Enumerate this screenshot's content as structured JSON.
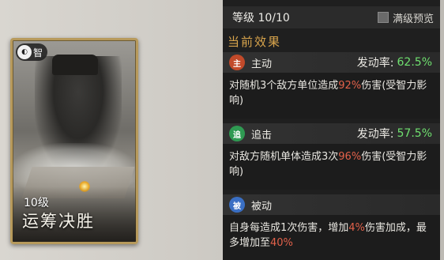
{
  "card": {
    "type_badge": "智",
    "level": "10级",
    "name": "运筹决胜"
  },
  "panel": {
    "level_text": "等级 10/10",
    "full_level_preview": "满级预览",
    "section_title": "当前效果",
    "effects": [
      {
        "icon": "主",
        "icon_color": "#c24a2a",
        "type": "主动",
        "rate_label": "发动率:",
        "rate": "62.5%",
        "desc_pre": "对随机3个敌方单位造成",
        "desc_hl": "92%",
        "desc_post": "伤害(受智力影响)"
      },
      {
        "icon": "追",
        "icon_color": "#2f9a52",
        "type": "追击",
        "rate_label": "发动率:",
        "rate": "57.5%",
        "desc_pre": "对敌方随机单体造成3次",
        "desc_hl": "96%",
        "desc_post": "伤害(受智力影响)"
      },
      {
        "icon": "被",
        "icon_color": "#3a6fc4",
        "type": "被动",
        "desc_pre": "自身每造成1次伤害，增加",
        "desc_hl": "4%",
        "desc_mid": "伤害加成，最多增加至",
        "desc_hl2": "40%"
      }
    ]
  },
  "colors": {
    "accent_gold": "#d8a44c",
    "rate_green": "#6fe06f",
    "highlight_red": "#e2614a"
  }
}
